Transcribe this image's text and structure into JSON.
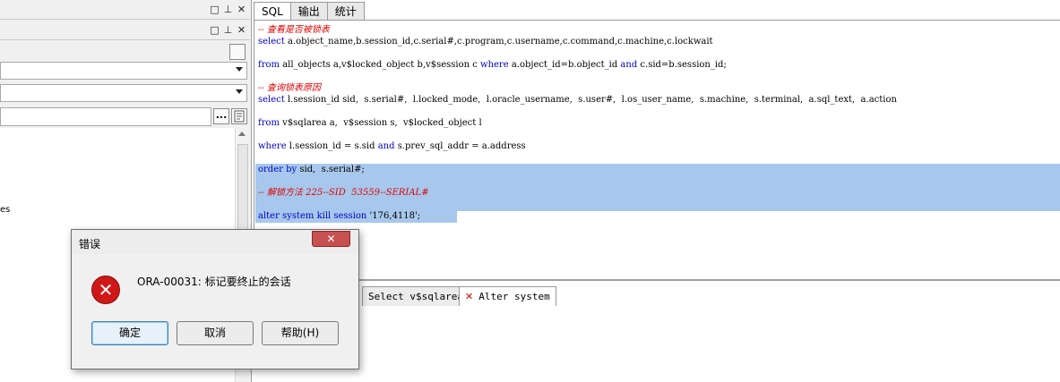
{
  "left_panel": {
    "panel_btns": [
      "□",
      "⊥",
      "✕"
    ],
    "browse_btn": "...",
    "tree_text": "es"
  },
  "editor": {
    "tabs": [
      {
        "label": "SQL",
        "active": true
      },
      {
        "label": "输出",
        "active": false
      },
      {
        "label": "统计",
        "active": false
      }
    ],
    "lines": {
      "c1": "-- 查看是否被锁表",
      "l1_kw": "select",
      "l1_rest": " a.object_name,b.session_id,c.serial#,c.program,c.username,c.command,c.machine,c.lockwait",
      "l2_kw1": "from",
      "l2_mid1": " all_objects a,v$locked_object b,v$session c ",
      "l2_kw2": "where",
      "l2_mid2": " a.object_id=b.object_id ",
      "l2_kw3": "and",
      "l2_end": " c.sid=b.session_id;",
      "c2": "-- 查询锁表原因",
      "l3_kw": "select",
      "l3_rest": " l.session_id sid,  s.serial#,  l.locked_mode,  l.oracle_username,  s.user#,  l.os_user_name,  s.machine,  s.terminal,  a.sql_text,  a.action",
      "l4_kw": "from",
      "l4_rest": " v$sqlarea a,  v$session s,  v$locked_object l",
      "l5_kw1": "where",
      "l5_mid": " l.session_id = s.sid ",
      "l5_kw2": "and",
      "l5_end": " s.prev_sql_addr = a.address",
      "l6_kw": "order by",
      "l6_rest": " sid,  s.serial#;",
      "c3": "-- 解锁方法 225--SID  53559--SERIAL#",
      "l7_kw": "alter system kill session",
      "l7_rest": " '176,4118';"
    }
  },
  "results": {
    "tabs": [
      {
        "label": "Select v$sqlarea",
        "active": false
      },
      {
        "label": "Alter system",
        "active": true,
        "error": true
      }
    ]
  },
  "dialog": {
    "title": "错误",
    "close": "✕",
    "message": "ORA-00031: 标记要终止的会话",
    "icon": "error-icon",
    "buttons": {
      "ok": "确定",
      "cancel": "取消",
      "help": "帮助(H)"
    }
  },
  "colors": {
    "keyword": "#0000c8",
    "comment": "#e00000",
    "selection": "#a7c8ec"
  }
}
